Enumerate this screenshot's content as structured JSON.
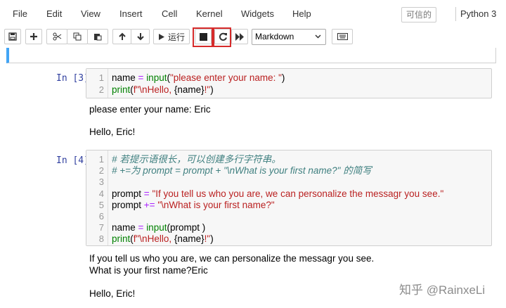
{
  "menubar": {
    "items": [
      "File",
      "Edit",
      "View",
      "Insert",
      "Cell",
      "Kernel",
      "Widgets",
      "Help"
    ],
    "trusted": "可信的",
    "kernel": "Python 3"
  },
  "toolbar": {
    "run_label": "运行",
    "cell_type": "Markdown",
    "icons": [
      "save-icon",
      "add-icon",
      "cut-icon",
      "copy-icon",
      "paste-icon",
      "up-icon",
      "down-icon",
      "run-icon",
      "stop-icon",
      "restart-icon",
      "fast-forward-icon",
      "keyboard-icon"
    ]
  },
  "cell3": {
    "prompt": "In [3]:",
    "lines": [
      {
        "n": "1",
        "parts": [
          [
            "",
            "name "
          ],
          [
            "op",
            "="
          ],
          [
            "",
            " "
          ],
          [
            "kw",
            "input"
          ],
          [
            "",
            "("
          ],
          [
            "st",
            "\"please enter your name: \""
          ],
          [
            "",
            ")"
          ]
        ]
      },
      {
        "n": "2",
        "parts": [
          [
            "kw",
            "print"
          ],
          [
            "",
            "("
          ],
          [
            "st",
            "f\"\\nHello, "
          ],
          [
            "",
            "{name}"
          ],
          [
            "st",
            "!\""
          ],
          [
            "",
            ")"
          ]
        ]
      }
    ],
    "output": [
      "please enter your name: Eric",
      "",
      "Hello, Eric!"
    ]
  },
  "cell4": {
    "prompt": "In [4]:",
    "lines": [
      {
        "n": "1",
        "parts": [
          [
            "cm",
            "# 若提示语很长，可以创建多行字符串。"
          ]
        ]
      },
      {
        "n": "2",
        "parts": [
          [
            "cm",
            "# +=为 prompt = prompt + \"\\nWhat is your first name?\" 的简写"
          ]
        ]
      },
      {
        "n": "3",
        "parts": []
      },
      {
        "n": "4",
        "parts": [
          [
            "",
            "prompt "
          ],
          [
            "op",
            "="
          ],
          [
            "",
            " "
          ],
          [
            "st",
            "\"If you tell us who you are, we can personalize the messagr you see.\""
          ]
        ]
      },
      {
        "n": "5",
        "parts": [
          [
            "",
            "prompt "
          ],
          [
            "op",
            "+="
          ],
          [
            "",
            " "
          ],
          [
            "st",
            "\"\\nWhat is your first name?\""
          ]
        ]
      },
      {
        "n": "6",
        "parts": []
      },
      {
        "n": "7",
        "parts": [
          [
            "",
            "name "
          ],
          [
            "op",
            "="
          ],
          [
            "",
            " "
          ],
          [
            "kw",
            "input"
          ],
          [
            "",
            "(prompt )"
          ]
        ]
      },
      {
        "n": "8",
        "parts": [
          [
            "kw",
            "print"
          ],
          [
            "",
            "("
          ],
          [
            "st",
            "f\"\\nHello, "
          ],
          [
            "",
            "{name}"
          ],
          [
            "st",
            "!\""
          ],
          [
            "",
            ")"
          ]
        ]
      }
    ],
    "output": [
      "If you tell us who you are, we can personalize the messagr you see.",
      "What is your first name?Eric",
      "",
      "Hello, Eric!"
    ]
  },
  "watermark": "知乎 @RainxeLi"
}
